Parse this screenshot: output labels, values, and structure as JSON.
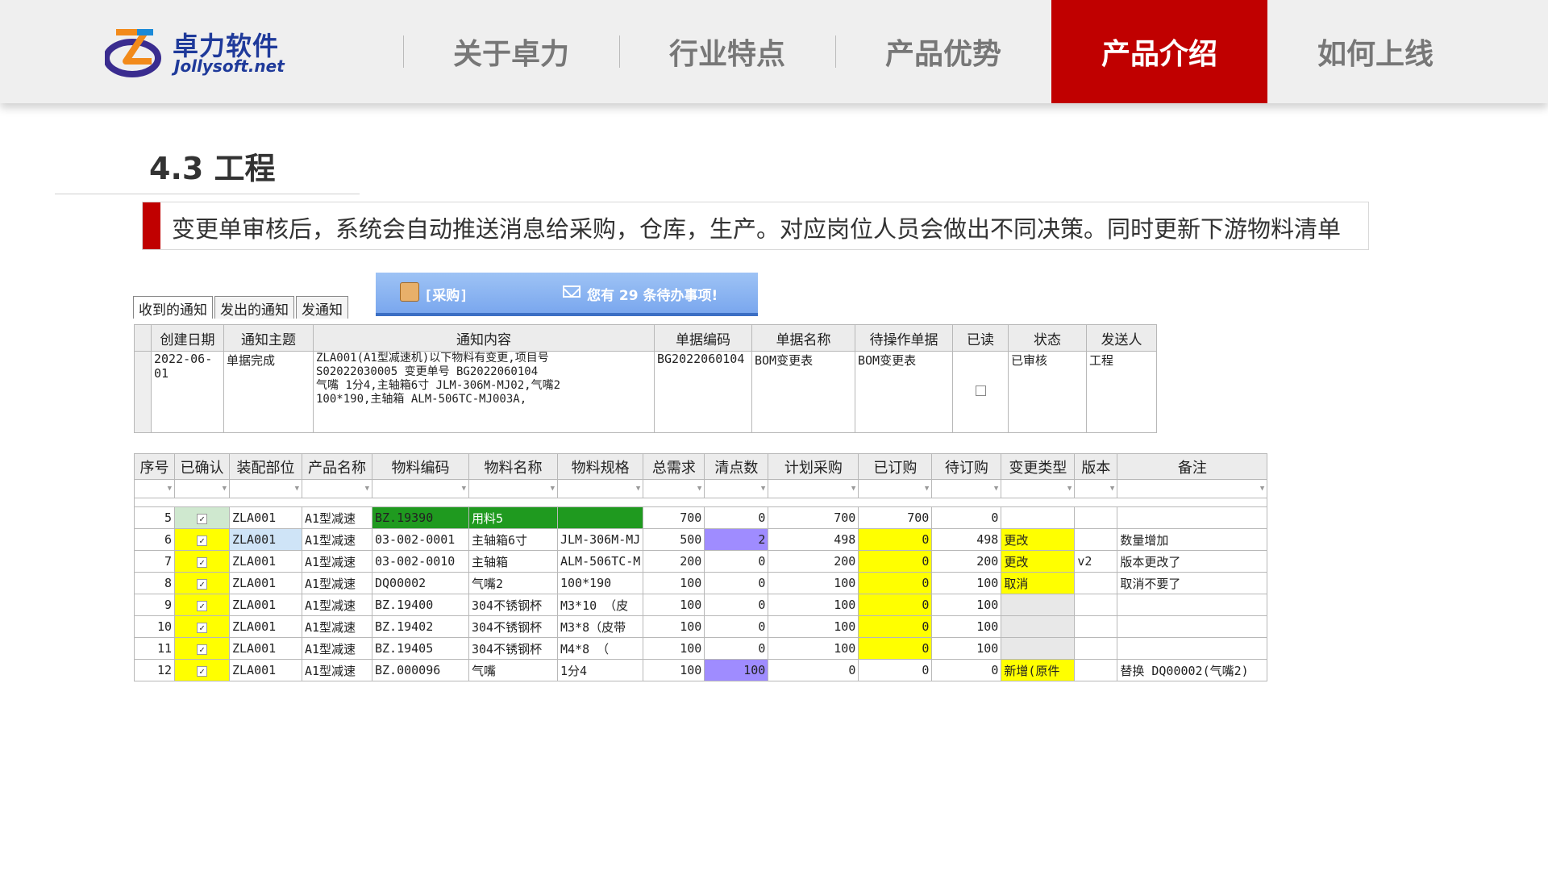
{
  "header": {
    "logo": {
      "cn": "卓力软件",
      "en": "Jollysoft.net",
      "mark": "ZL"
    },
    "nav": [
      {
        "label": "关于卓力",
        "active": false
      },
      {
        "label": "行业特点",
        "active": false
      },
      {
        "label": "产品优势",
        "active": false
      },
      {
        "label": "产品介绍",
        "active": true
      },
      {
        "label": "如何上线",
        "active": false
      }
    ],
    "active_color": "#c00000"
  },
  "section": {
    "title": "4.3 工程",
    "callout": "变更单审核后，系统会自动推送消息给采购，仓库，生产。对应岗位人员会做出不同决策。同时更新下游物料清单"
  },
  "notice": {
    "role": "[采购]",
    "todo": "您有 29 条待办事项!",
    "tabs": [
      "收到的通知",
      "发出的通知",
      "发通知"
    ],
    "columns": [
      "创建日期",
      "通知主题",
      "通知内容",
      "单据编码",
      "单据名称",
      "待操作单据",
      "已读",
      "状态",
      "发送人"
    ],
    "row": {
      "date": "2022-06-01",
      "subject": "单据完成",
      "content_lines": [
        "ZLA001(A1型减速机)以下物料有变更,项目号",
        "S02022030005 变更单号 BG2022060104",
        "气嘴 1分4,主轴箱6寸 JLM-306M-MJ02,气嘴2",
        "100*190,主轴箱 ALM-506TC-MJ003A,"
      ],
      "doc_code": "BG2022060104",
      "doc_name": "BOM变更表",
      "pending_doc": "BOM变更表",
      "read": false,
      "status": "已审核",
      "sender": "工程"
    }
  },
  "bom": {
    "columns": [
      "序号",
      "已确认",
      "装配部位",
      "产品名称",
      "物料编码",
      "物料名称",
      "物料规格",
      "总需求",
      "清点数",
      "计划采购",
      "已订购",
      "待订购",
      "变更类型",
      "版本",
      "备注"
    ],
    "rows": [
      {
        "seq": "5",
        "part": "ZLA001",
        "product": "A1型减速",
        "code": "BZ.19390",
        "name": "用料5",
        "spec": "",
        "total": "700",
        "count": "0",
        "plan": "700",
        "ordered": "700",
        "pending": "0",
        "change": "",
        "ver": "",
        "note": ""
      },
      {
        "seq": "6",
        "part": "ZLA001",
        "product": "A1型减速",
        "code": "03-002-0001",
        "name": "主轴箱6寸",
        "spec": "JLM-306M-MJ",
        "total": "500",
        "count": "2",
        "plan": "498",
        "ordered": "0",
        "pending": "498",
        "change": "更改",
        "ver": "",
        "note": "数量增加"
      },
      {
        "seq": "7",
        "part": "ZLA001",
        "product": "A1型减速",
        "code": "03-002-0010",
        "name": "主轴箱",
        "spec": "ALM-506TC-M",
        "total": "200",
        "count": "0",
        "plan": "200",
        "ordered": "0",
        "pending": "200",
        "change": "更改",
        "ver": "v2",
        "note": "版本更改了"
      },
      {
        "seq": "8",
        "part": "ZLA001",
        "product": "A1型减速",
        "code": "DQ00002",
        "name": "气嘴2",
        "spec": "100*190",
        "total": "100",
        "count": "0",
        "plan": "100",
        "ordered": "0",
        "pending": "100",
        "change": "取消",
        "ver": "",
        "note": "取消不要了"
      },
      {
        "seq": "9",
        "part": "ZLA001",
        "product": "A1型减速",
        "code": "BZ.19400",
        "name": "304不锈钢杯",
        "spec": "M3*10 （皮",
        "total": "100",
        "count": "0",
        "plan": "100",
        "ordered": "0",
        "pending": "100",
        "change": "",
        "ver": "",
        "note": ""
      },
      {
        "seq": "10",
        "part": "ZLA001",
        "product": "A1型减速",
        "code": "BZ.19402",
        "name": "304不锈钢杯",
        "spec": "M3*8（皮带",
        "total": "100",
        "count": "0",
        "plan": "100",
        "ordered": "0",
        "pending": "100",
        "change": "",
        "ver": "",
        "note": ""
      },
      {
        "seq": "11",
        "part": "ZLA001",
        "product": "A1型减速",
        "code": "BZ.19405",
        "name": "304不锈钢杯",
        "spec": "M4*8 （",
        "total": "100",
        "count": "0",
        "plan": "100",
        "ordered": "0",
        "pending": "100",
        "change": "",
        "ver": "",
        "note": ""
      },
      {
        "seq": "12",
        "part": "ZLA001",
        "product": "A1型减速",
        "code": "BZ.000096",
        "name": "气嘴",
        "spec": "1分4",
        "total": "100",
        "count": "100",
        "plan": "0",
        "ordered": "0",
        "pending": "0",
        "change": "新增(原件",
        "ver": "",
        "note": "替换 DQ00002(气嘴2)"
      }
    ]
  }
}
